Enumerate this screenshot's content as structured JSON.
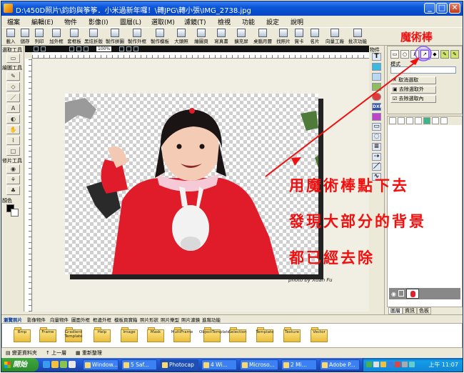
{
  "window": {
    "title": "D:\\450D照片\\鈞鈞與筝筝．小米過新年囉！\\轉JPG\\轉小張\\IMG_2738.jpg"
  },
  "menu": [
    "檔案",
    "編輯(E)",
    "物件",
    "影像(I)",
    "圖層(L)",
    "選取(M)",
    "濾鏡(T)",
    "檢視",
    "功能",
    "設定",
    "說明"
  ],
  "toolbar": [
    "載入",
    "儲存",
    "列印",
    "加外框",
    "套框板",
    "黑炫折版",
    "製作拼圖",
    "製作外框",
    "製作模板",
    "大頭照",
    "繪圖頁",
    "寫真書",
    "擴充屏",
    "桌腦月曆",
    "找照片",
    "賀卡",
    "名片",
    "向量工廠",
    "批次功能"
  ],
  "left_tools": {
    "select_header": "選取工具",
    "draw_header": "繪圖工具",
    "fix_header": "修片工具",
    "color_header": "顏色"
  },
  "canvas": {
    "zoom": "100%",
    "photo_credit": "photo by Xuan Fu"
  },
  "annotation": {
    "magic_wand_label": "魔術棒",
    "lines": [
      "用魔術棒點下去",
      "發現大部分的背景",
      "都已經去除"
    ],
    "color": "#f01010"
  },
  "right_panel": {
    "objects_header": "物件",
    "mode_label": "模式",
    "actions": [
      "取消選取",
      "去除選取外",
      "去除選取內"
    ],
    "tabs": [
      "圖層",
      "資訊",
      "色板"
    ]
  },
  "library": {
    "tabs": [
      "瀏覽照片",
      "影像物件",
      "向量物件",
      "圖面外框",
      "框邊外框",
      "模板頁寶箱",
      "照片形狀",
      "照片樂型",
      "照片濾鏡",
      "進階功能"
    ],
    "folders": [
      "Bmp",
      "Frame",
      "Gradient Template",
      "Help",
      "Image",
      "Mask",
      "MultiFrame",
      "ObjectTemplate",
      "Selection",
      "Template",
      "Texture",
      "Vector"
    ],
    "status": [
      "變更資料夾",
      "上一層",
      "重新整理"
    ]
  },
  "taskbar": {
    "start_label": "開始",
    "tasks": [
      "Window...",
      "5 Saf...",
      "Photocap",
      "4 Wi...",
      "Microso...",
      "2 Mi...",
      "Adobe P..."
    ],
    "active_task": "Photocap",
    "clock": "上午 11:07"
  }
}
